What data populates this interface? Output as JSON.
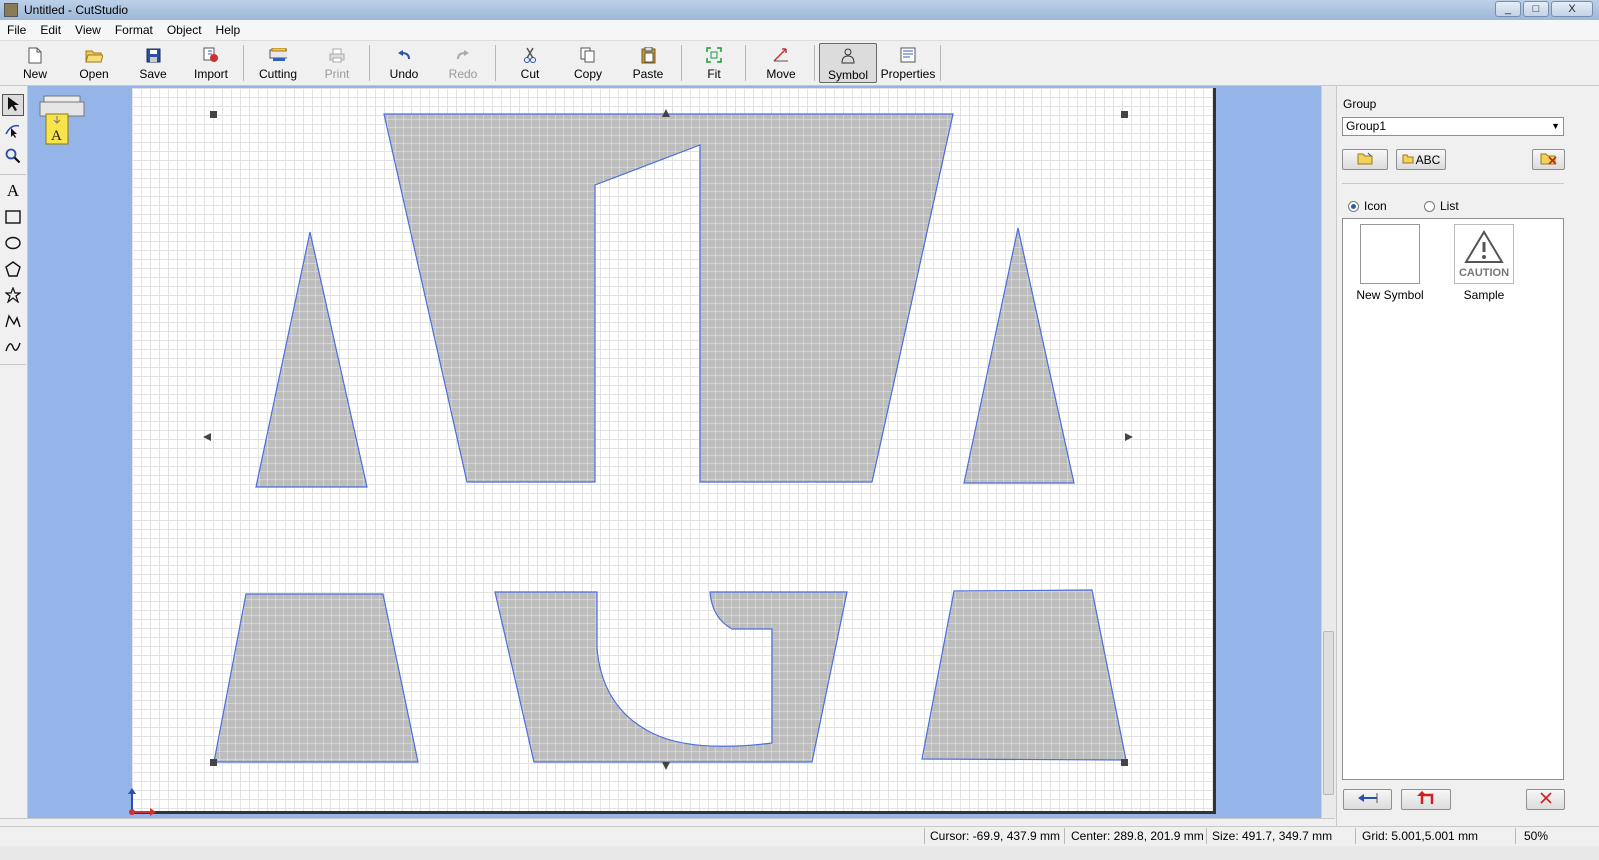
{
  "window": {
    "title": "Untitled - CutStudio",
    "controls": [
      "_",
      "□",
      "X"
    ]
  },
  "menu": [
    "File",
    "Edit",
    "View",
    "Format",
    "Object",
    "Help"
  ],
  "toolbar": {
    "new": "New",
    "open": "Open",
    "save": "Save",
    "import": "Import",
    "cutting": "Cutting",
    "print": "Print",
    "undo": "Undo",
    "redo": "Redo",
    "cut": "Cut",
    "copy": "Copy",
    "paste": "Paste",
    "fit": "Fit",
    "move": "Move",
    "symbol": "Symbol",
    "properties": "Properties"
  },
  "tools": [
    "select-icon",
    "node-edit-icon",
    "zoom-icon",
    "text-icon",
    "rectangle-icon",
    "ellipse-icon",
    "polygon-icon",
    "star-icon",
    "polyline-icon",
    "curve-icon"
  ],
  "tool_text_glyph": "A",
  "printer_glyph": "A",
  "panel": {
    "group_label": "Group",
    "group_value": "Group1",
    "abc_button": "ABC",
    "view_icon": "Icon",
    "view_list": "List",
    "view_selected": "Icon",
    "symbols": [
      {
        "label": "New Symbol"
      },
      {
        "label": "Sample",
        "thumb_text": "CAUTION"
      }
    ]
  },
  "status": {
    "cursor": "Cursor: -69.9, 437.9 mm",
    "center": "Center: 289.8, 201.9 mm",
    "size": "Size: 491.7, 349.7 mm",
    "grid": "Grid: 5.001,5.001 mm",
    "zoom": "50%"
  },
  "colors": {
    "shape_fill": "#c0c0c0",
    "shape_stroke": "#4a6ee0",
    "workspace": "#95b4e8",
    "paper": "#ffffff"
  }
}
